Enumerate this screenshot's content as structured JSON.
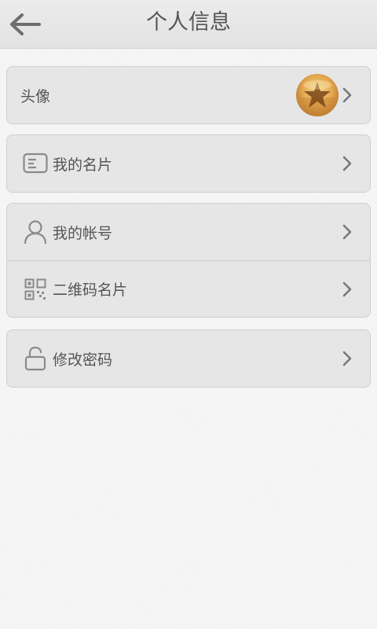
{
  "header": {
    "title": "个人信息",
    "back_icon": "back-arrow-icon"
  },
  "sections": [
    {
      "rows": [
        {
          "label": "头像",
          "icon": null,
          "has_avatar": true,
          "avatar_icon": "starfish-avatar"
        }
      ]
    },
    {
      "rows": [
        {
          "label": "我的名片",
          "icon": "business-card-icon"
        }
      ]
    },
    {
      "rows": [
        {
          "label": "我的帐号",
          "icon": "user-icon"
        },
        {
          "label": "二维码名片",
          "icon": "qr-code-icon"
        }
      ]
    },
    {
      "rows": [
        {
          "label": "修改密码",
          "icon": "unlock-icon"
        }
      ]
    }
  ],
  "colors": {
    "background": "#f6f6f6",
    "card": "#e6e6e6",
    "text": "#555555",
    "icon": "#8a8a8a"
  }
}
